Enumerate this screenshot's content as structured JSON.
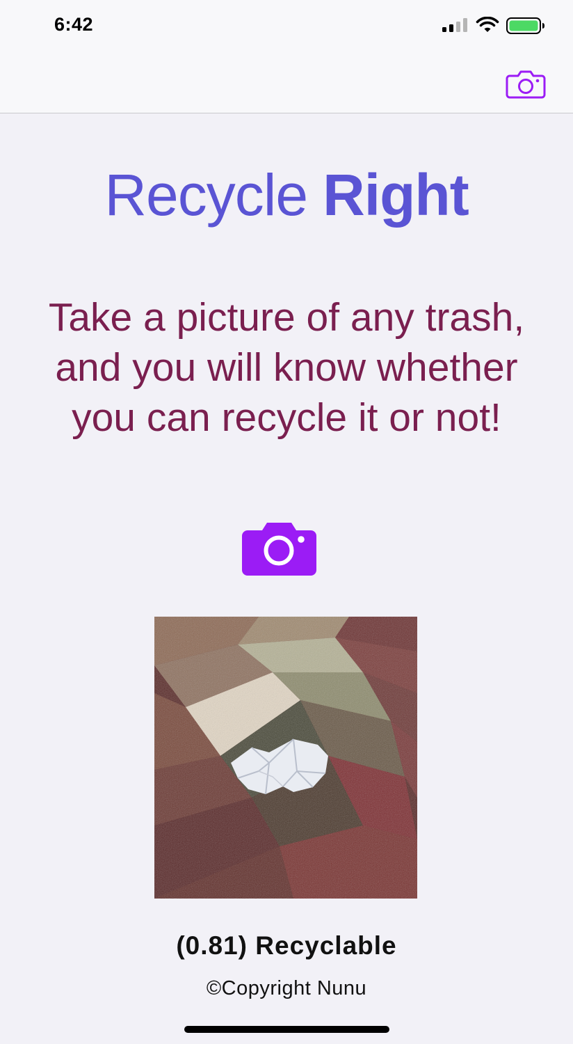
{
  "status_bar": {
    "time": "6:42",
    "icons": [
      "signal-icon",
      "wifi-icon",
      "battery-icon"
    ]
  },
  "nav_bar": {
    "right_icon": "camera-icon"
  },
  "title": {
    "part1": "Recycle",
    "part2": "Right"
  },
  "subtitle": "Take a picture of any trash, and you will know whether you can recycle it or not!",
  "camera_button_icon": "camera-icon",
  "photo": {
    "description_icon": "captured-photo"
  },
  "result_text": "(0.81) Recyclable",
  "copyright": "©Copyright Nunu",
  "colors": {
    "accent": "#9b1cf5",
    "title": "#5a54d4",
    "subtitle": "#7a1f4f",
    "background": "#f2f1f7"
  }
}
